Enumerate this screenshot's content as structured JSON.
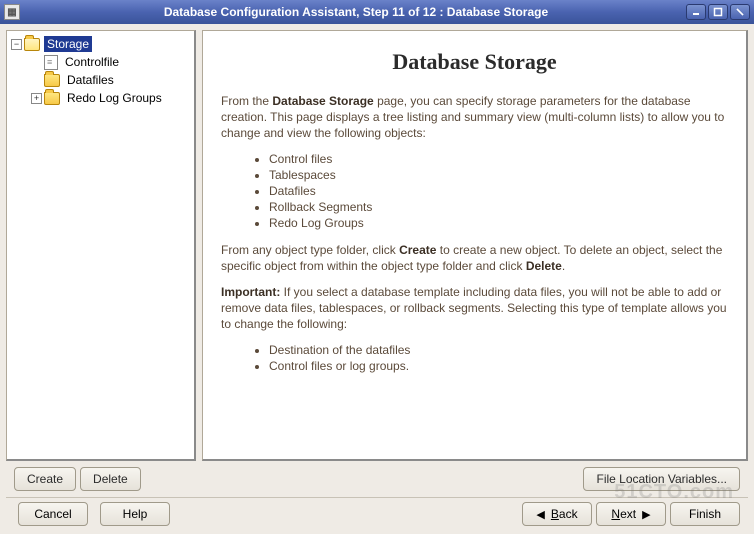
{
  "window": {
    "title": "Database Configuration Assistant, Step 11 of 12 : Database Storage"
  },
  "tree": {
    "items": [
      {
        "label": "Storage",
        "level": 0,
        "icon": "folder-open",
        "toggle": "minus",
        "selected": true
      },
      {
        "label": "Controlfile",
        "level": 1,
        "icon": "file",
        "toggle": "none",
        "selected": false
      },
      {
        "label": "Datafiles",
        "level": 1,
        "icon": "folder",
        "toggle": "none",
        "selected": false
      },
      {
        "label": "Redo Log Groups",
        "level": 1,
        "icon": "folder",
        "toggle": "plus",
        "selected": false
      }
    ]
  },
  "content": {
    "heading": "Database Storage",
    "para1_a": "From the ",
    "para1_bold": "Database Storage",
    "para1_b": " page, you can specify storage parameters for the database creation. This page displays a tree listing and summary view (multi-column lists) to allow you to change and view the following objects:",
    "list1": [
      "Control files",
      "Tablespaces",
      "Datafiles",
      "Rollback Segments",
      "Redo Log Groups"
    ],
    "para2_a": "From any object type folder, click ",
    "para2_bold1": "Create",
    "para2_b": " to create a new object. To delete an object, select the specific object from within the object type folder and click ",
    "para2_bold2": "Delete",
    "para2_c": ".",
    "para3_bold": "Important:",
    "para3_a": " If you select a database template including data files, you will not be able to add or remove data files, tablespaces, or rollback segments. Selecting this type of template allows you to change the following:",
    "list2": [
      "Destination of the datafiles",
      "Control files or log groups."
    ]
  },
  "buttons": {
    "create": "Create",
    "delete": "Delete",
    "flv": "File Location Variables...",
    "cancel": "Cancel",
    "help": "Help",
    "back": "Back",
    "next": "Next",
    "finish": "Finish"
  },
  "watermark": "51CTO.com"
}
